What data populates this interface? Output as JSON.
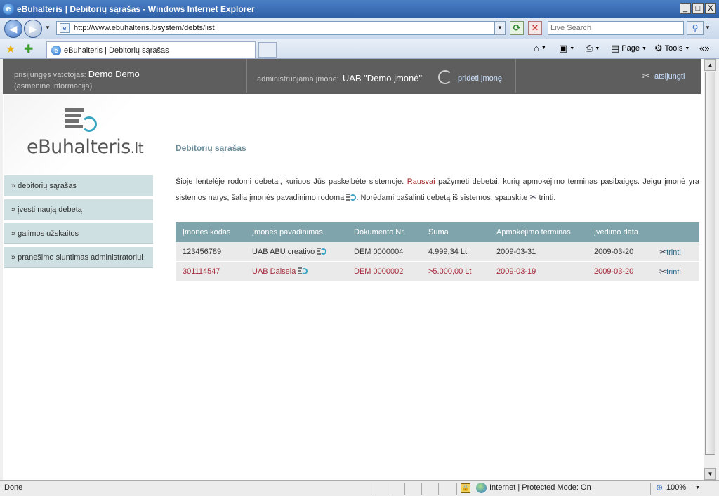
{
  "window": {
    "title": "eBuhalteris | Debitorių sąrašas - Windows Internet Explorer",
    "minimize": "_",
    "maximize": "□",
    "close": "X"
  },
  "address": {
    "url": "http://www.ebuhalteris.lt/system/debts/list",
    "search_placeholder": "Live Search"
  },
  "tab": {
    "label": "eBuhalteris | Debitorių sąrašas"
  },
  "commands": {
    "page": "Page",
    "tools": "Tools"
  },
  "header": {
    "logged_in_label": "prisijungęs vatotojas:",
    "user_name": "Demo Demo",
    "personal_info_link": "(asmeninė informacija)",
    "company_label": "administruojama įmonė:",
    "company_name": "UAB \"Demo įmonė\"",
    "add_company_link": "pridėti įmonę",
    "logout_link": "atsijungti"
  },
  "logo": {
    "name": "eBuhalteris",
    "tld": ".lt"
  },
  "sidebar": {
    "items": [
      {
        "label": "» debitorių sąrašas"
      },
      {
        "label": "» įvesti naują debetą"
      },
      {
        "label": "» galimos užskaitos"
      },
      {
        "label": "» pranešimo siuntimas administratoriui"
      }
    ]
  },
  "main": {
    "title": "Debitorių sąrašas",
    "desc_part1": "Šioje lentelėje rodomi debetai, kuriuos Jūs paskelbėte sistemoje.",
    "desc_red": "Rausvai",
    "desc_part2": "pažymėti debetai, kurių apmokėjimo terminas pasibaigęs. Jeigu įmonė yra sistemos narys, šalia įmonės pavadinimo rodoma",
    "desc_part3": ". Norėdami pašalinti debetą iš sistemos, spauskite",
    "desc_part4": "trinti."
  },
  "table": {
    "headers": [
      "Įmonės kodas",
      "Įmonės pavadinimas",
      "Dokumento Nr.",
      "Suma",
      "Apmokėjimo terminas",
      "Įvedimo data"
    ],
    "rows": [
      {
        "code": "123456789",
        "company": "UAB ABU creativo",
        "doc": "DEM 0000004",
        "sum": "4.999,34 Lt",
        "due": "2009-03-31",
        "entered": "2009-03-20",
        "action": "trinti",
        "overdue": false
      },
      {
        "code": "301114547",
        "company": "UAB Daisela",
        "doc": "DEM 0000002",
        "sum": ">5.000,00 Lt",
        "due": "2009-03-19",
        "entered": "2009-03-20",
        "action": "trinti",
        "overdue": true
      }
    ]
  },
  "statusbar": {
    "status": "Done",
    "zone": "Internet | Protected Mode: On",
    "zoom": "100%"
  },
  "colors": {
    "header_bg": "#5e5e5e",
    "table_header": "#7fa4ac",
    "overdue_text": "#a52a3a",
    "menu_bg": "#cfe0e2"
  }
}
